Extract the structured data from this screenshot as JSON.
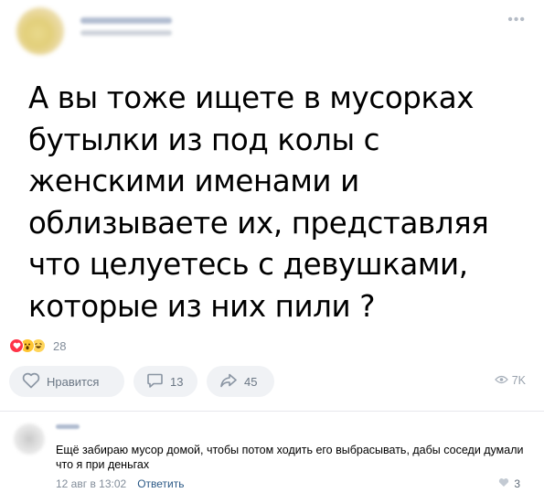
{
  "post": {
    "text": "А вы тоже ищете в мусорках\nбутылки из под колы с\nженскими именами и\nоблизываете их, представляя\nчто целуетесь с девушками,\nкоторые  из них пили ?",
    "more_icon": "more-horizontal-icon"
  },
  "reactions": {
    "icons": [
      "heart-icon",
      "wow-icon",
      "laugh-icon"
    ],
    "count": "28"
  },
  "actions": {
    "like_label": "Нравится",
    "comments_count": "13",
    "shares_count": "45",
    "views_count": "7K"
  },
  "comment": {
    "text": "Ещё забираю мусор домой, чтобы потом ходить его выбрасывать, дабы соседи думали что я при деньгах",
    "time": "12 авг в 13:02",
    "reply_label": "Ответить",
    "likes": "3"
  },
  "colors": {
    "accent": "#2a5885",
    "secondary_text": "#818c99",
    "pill_bg": "#f0f2f5",
    "heart": "#ff3347"
  }
}
